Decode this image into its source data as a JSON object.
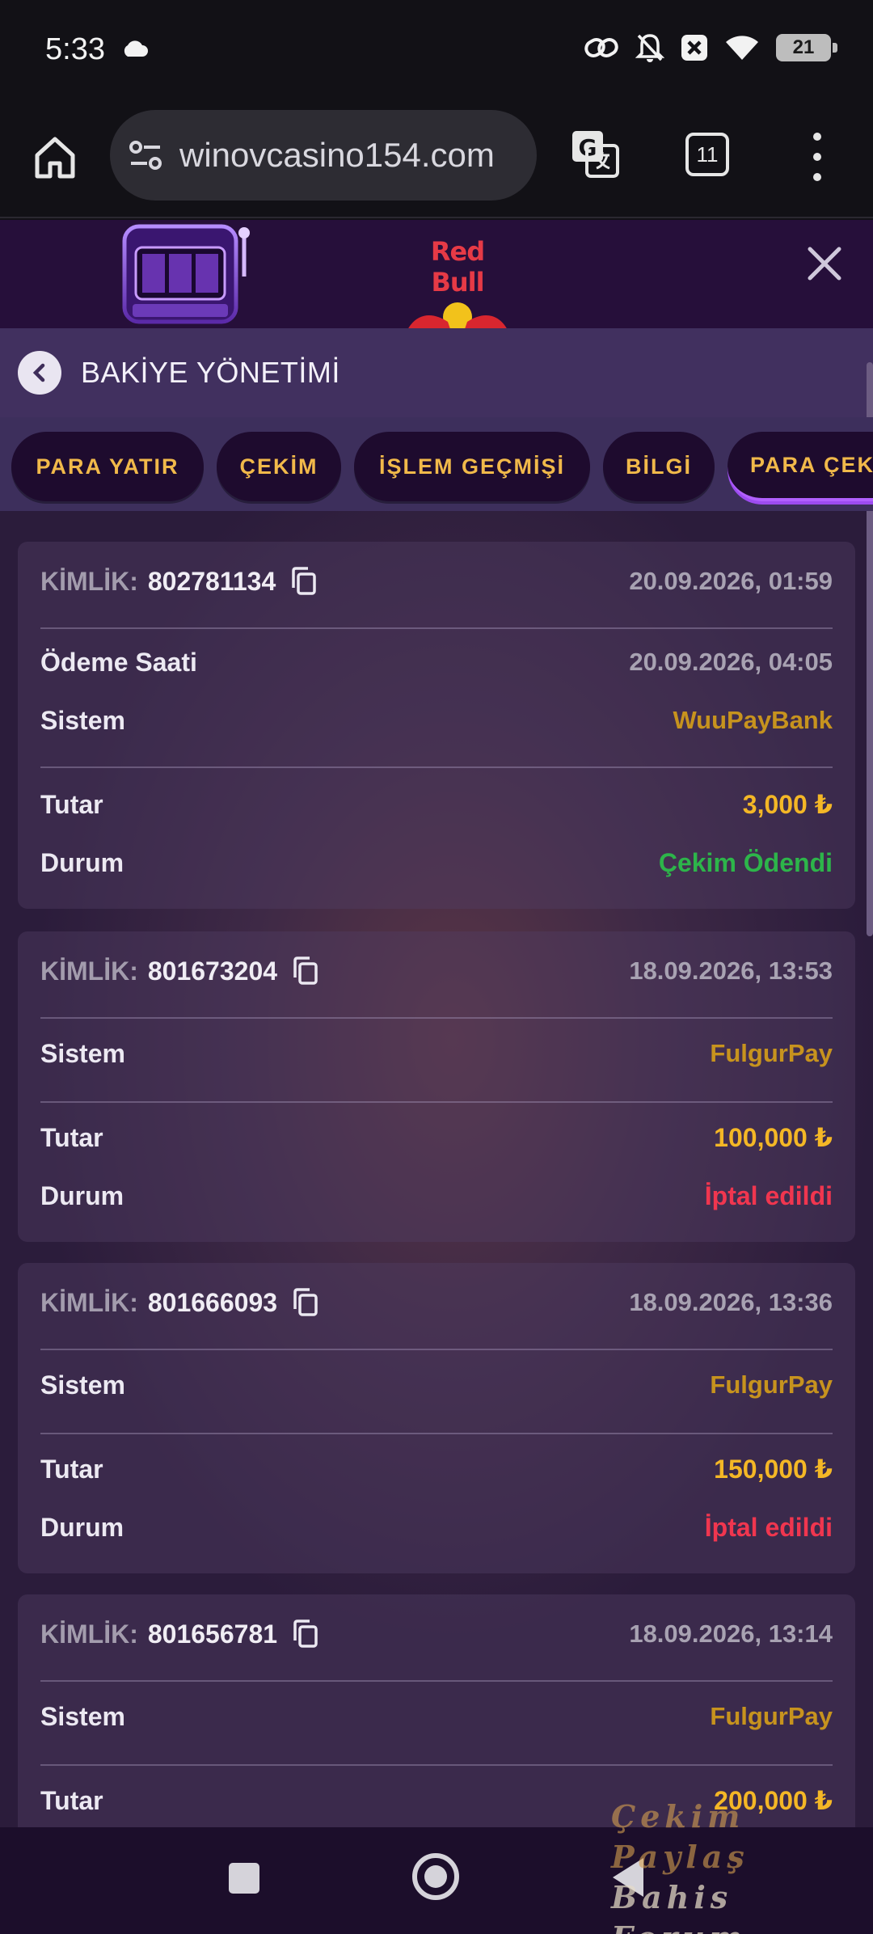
{
  "status_bar": {
    "time": "5:33",
    "battery": "21"
  },
  "browser": {
    "url": "winovcasino154.com",
    "tab_count": "11"
  },
  "header": {
    "brand": "Red Bull"
  },
  "page": {
    "title": "BAKİYE YÖNETİMİ",
    "tabs": [
      {
        "label": "PARA YATIR"
      },
      {
        "label": "ÇEKİM"
      },
      {
        "label": "İŞLEM GEÇMİŞİ"
      },
      {
        "label": "BİLGİ"
      },
      {
        "label": "PARA ÇEKME"
      }
    ]
  },
  "labels": {
    "id": "KİMLİK:",
    "payment_time": "Ödeme Saati",
    "system": "Sistem",
    "amount": "Tutar",
    "status": "Durum"
  },
  "transactions": [
    {
      "id": "802781134",
      "date": "20.09.2026, 01:59",
      "payment_time": "20.09.2026, 04:05",
      "system": "WuuPayBank",
      "amount": "3,000 ₺",
      "status": "Çekim Ödendi",
      "status_color": "#2db54a"
    },
    {
      "id": "801673204",
      "date": "18.09.2026, 13:53",
      "system": "FulgurPay",
      "amount": "100,000 ₺",
      "status": "İptal edildi",
      "status_color": "#f0364f"
    },
    {
      "id": "801666093",
      "date": "18.09.2026, 13:36",
      "system": "FulgurPay",
      "amount": "150,000 ₺",
      "status": "İptal edildi",
      "status_color": "#f0364f"
    },
    {
      "id": "801656781",
      "date": "18.09.2026, 13:14",
      "system": "FulgurPay",
      "amount": "200,000 ₺"
    }
  ],
  "watermark": {
    "line1": "Çekim Paylaş",
    "line2": "Bahis Forum"
  }
}
